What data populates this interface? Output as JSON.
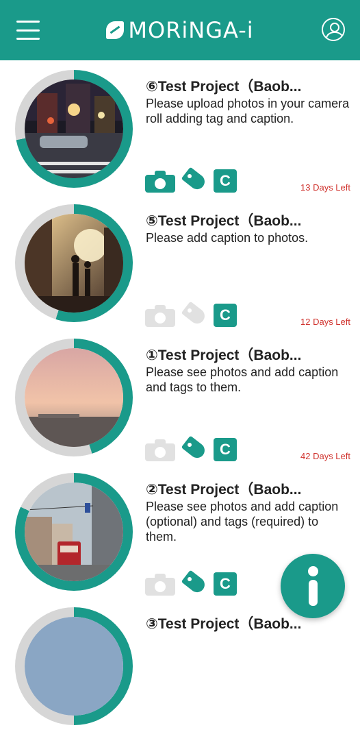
{
  "header": {
    "logo_text": "MORiNGA-i",
    "bg_color": "#1a9a8a"
  },
  "projects": [
    {
      "title": "⑥Test Project（Baob...",
      "description": "Please upload photos in your camera roll adding tag and caption.",
      "days_left": "13 Days Left",
      "progress": 0.72,
      "camera_active": true,
      "tag_active": true,
      "caption_active": true,
      "photo": "night-street"
    },
    {
      "title": "⑤Test Project（Baob...",
      "description": "Please add caption to photos.",
      "days_left": "12 Days Left",
      "progress": 0.55,
      "camera_active": false,
      "tag_active": false,
      "caption_active": true,
      "photo": "sunset-street"
    },
    {
      "title": "①Test Project（Baob...",
      "description": "Please see photos and add caption and tags to them.",
      "days_left": "42 Days Left",
      "progress": 0.45,
      "camera_active": false,
      "tag_active": true,
      "caption_active": true,
      "photo": "pink-sky"
    },
    {
      "title": "②Test Project（Baob...",
      "description": "Please see photos and add caption (optional) and tags (required) to them.",
      "days_left": "",
      "progress": 0.82,
      "camera_active": false,
      "tag_active": true,
      "caption_active": true,
      "photo": "tram-street"
    },
    {
      "title": "③Test Project（Baob...",
      "description": "",
      "days_left": "",
      "progress": 0.5,
      "camera_active": false,
      "tag_active": false,
      "caption_active": false,
      "photo": "blue-sky"
    }
  ],
  "icons": {
    "menu": "hamburger-menu-icon",
    "profile": "user-profile-icon",
    "camera": "camera-icon",
    "tag": "tag-icon",
    "caption": "caption-icon",
    "info": "info-icon"
  },
  "labels": {
    "caption_icon_letter": "C"
  },
  "colors": {
    "accent": "#1a9a8a",
    "inactive": "#e1e1e1",
    "ring_track": "#d6d6d6",
    "days_left": "#d0332e"
  }
}
